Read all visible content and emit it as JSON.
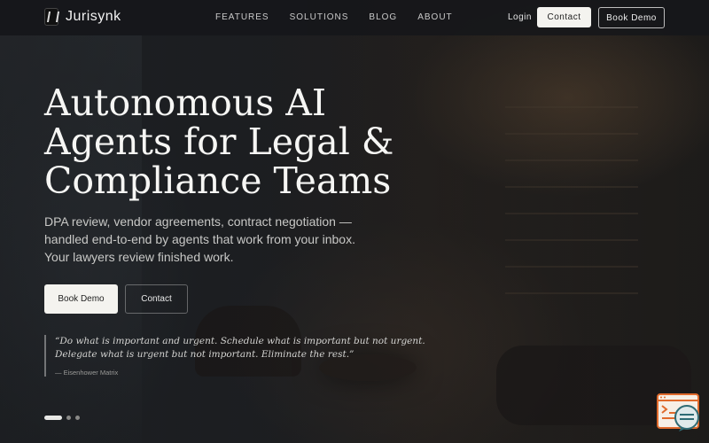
{
  "brand": {
    "name": "Jurisynk"
  },
  "nav": {
    "links": [
      "FEATURES",
      "SOLUTIONS",
      "BLOG",
      "ABOUT"
    ],
    "login": "Login",
    "contact": "Contact",
    "book_demo": "Book Demo"
  },
  "hero": {
    "title": "Autonomous AI Agents for Legal & Compliance Teams",
    "subtitle": "DPA review, vendor agreements, contract negotiation — handled end-to-end by agents that work from your inbox. Your lawyers review finished work.",
    "primary_cta": "Book Demo",
    "secondary_cta": "Contact"
  },
  "quote": {
    "text": "“Do what is important and urgent. Schedule what is important but not urgent. Delegate what is urgent but not important. Eliminate the rest.”",
    "source": "— Eisenhower Matrix"
  },
  "carousel": {
    "total": 3,
    "active": 1
  },
  "icons": {
    "brand": "hourglass-logo-icon",
    "chat": "chat-widget-icon"
  },
  "colors": {
    "accent": "#f4f3ef",
    "widget": "#e06a2c",
    "widget_teal": "#2f6b74"
  }
}
